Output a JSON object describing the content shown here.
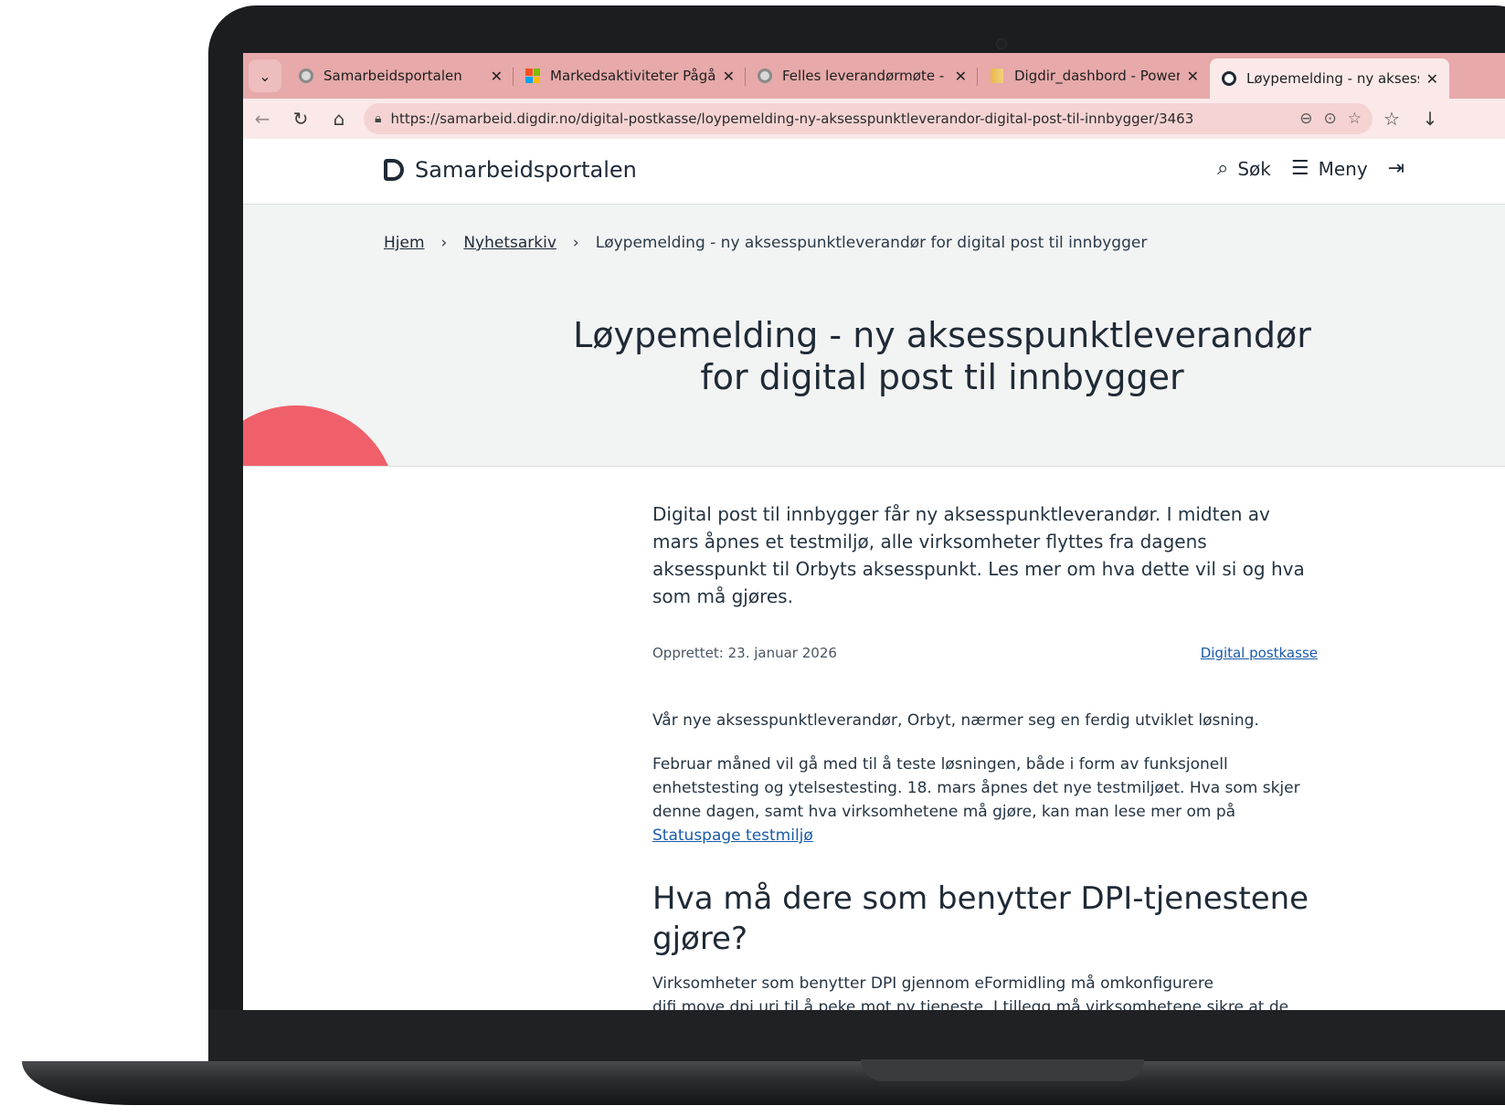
{
  "browser": {
    "tabs": [
      {
        "title": "Samarbeidsportalen",
        "favicon": "samarbeid-icon"
      },
      {
        "title": "Markedsaktiviteter Pågående",
        "favicon": "microsoft-icon"
      },
      {
        "title": "Felles leverandørmøte - samh",
        "favicon": "samarbeid-icon"
      },
      {
        "title": "Digdir_dashbord - Power BI",
        "favicon": "powerbi-icon"
      },
      {
        "title": "Løypemelding - ny aksesspun",
        "favicon": "digdir-icon",
        "active": true
      }
    ],
    "url": "https://samarbeid.digdir.no/digital-postkasse/loypemelding-ny-aksesspunktleverandor-digital-post-til-innbygger/3463"
  },
  "header": {
    "site_name": "Samarbeidsportalen",
    "search_label": "Søk",
    "menu_label": "Meny"
  },
  "breadcrumb": {
    "home": "Hjem",
    "archive": "Nyhetsarkiv",
    "current": "Løypemelding - ny aksesspunktleverandør for digital post til innbygger"
  },
  "article": {
    "title_line1": "Løypemelding - ny aksesspunktleverandør",
    "title_line2": "for digital post til innbygger",
    "lead": "Digital post til innbygger får ny aksesspunktleverandør. I midten av mars åpnes et testmiljø, alle virksomheter flyttes fra dagens aksesspunkt til Orbyts aksesspunkt. Les mer om hva dette vil si og hva som må gjøres.",
    "created": "Opprettet: 23. januar 2026",
    "category": "Digital postkasse",
    "p1": "Vår nye aksesspunktleverandør, Orbyt, nærmer seg en ferdig utviklet løsning.",
    "p2": "Februar måned vil gå med til å teste løsningen, både i form av funksjonell enhetstesting og ytelsestesting. 18. mars åpnes det nye testmiljøet. Hva som skjer denne dagen, samt hva virksomhetene må gjøre, kan man lese mer om på",
    "p2_link": "Statuspage testmiljø",
    "h2": "Hva må dere som benytter DPI-tjenestene gjøre?",
    "p3": "Virksomheter som benytter DPI gjennom eFormidling må omkonfigurere difi.move.dpi.uri til å peke mot ny tjeneste. I tillegg må virksomhetene sikre at de kan"
  },
  "colors": {
    "tabstrip": "#e7a9a9",
    "accent_red": "#f0606a",
    "text_dark": "#1f2a36",
    "link": "#1a5aa8"
  }
}
